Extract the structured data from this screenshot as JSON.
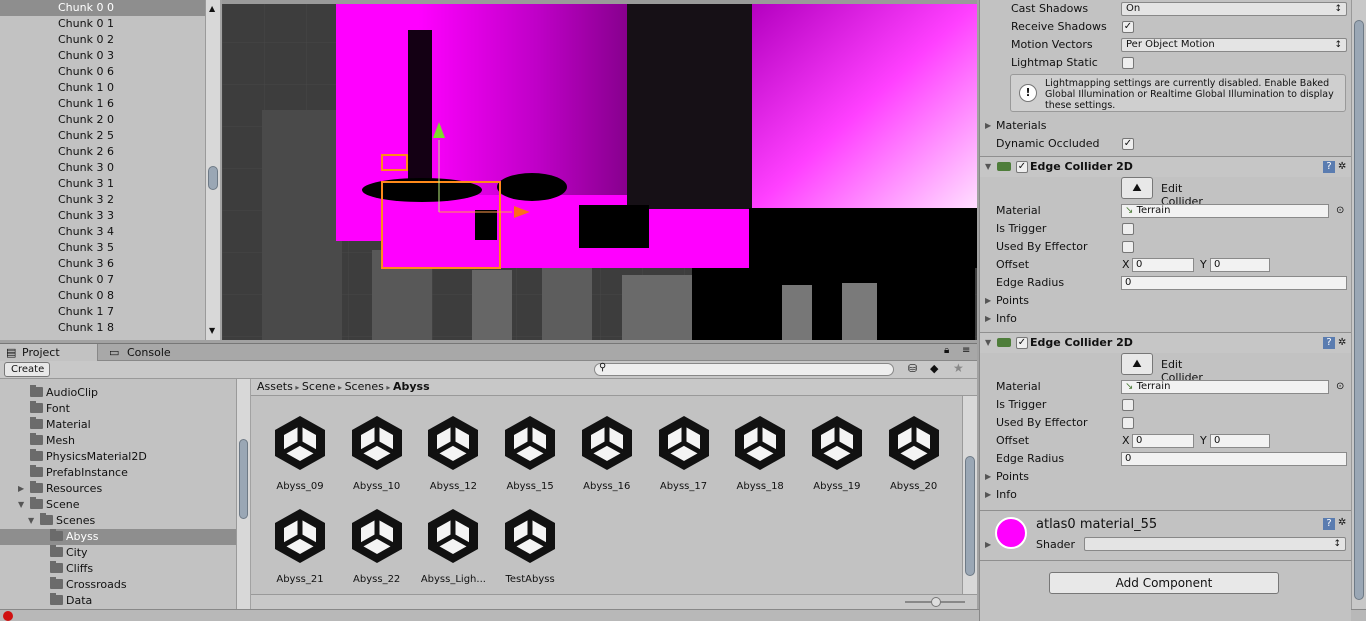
{
  "hierarchy": {
    "items": [
      "Chunk 0 0",
      "Chunk 0 1",
      "Chunk 0 2",
      "Chunk 0 3",
      "Chunk 0 6",
      "Chunk 1 0",
      "Chunk 1 6",
      "Chunk 2 0",
      "Chunk 2 5",
      "Chunk 2 6",
      "Chunk 3 0",
      "Chunk 3 1",
      "Chunk 3 2",
      "Chunk 3 3",
      "Chunk 3 4",
      "Chunk 3 5",
      "Chunk 3 6",
      "Chunk 0 7",
      "Chunk 0 8",
      "Chunk 1 7",
      "Chunk 1 8"
    ],
    "selected_index": 0
  },
  "project": {
    "tabs": [
      "Project",
      "Console"
    ],
    "create_label": "Create",
    "tree": [
      {
        "label": "AudioClip",
        "indent": 1
      },
      {
        "label": "Font",
        "indent": 1
      },
      {
        "label": "Material",
        "indent": 1
      },
      {
        "label": "Mesh",
        "indent": 1
      },
      {
        "label": "PhysicsMaterial2D",
        "indent": 1
      },
      {
        "label": "PrefabInstance",
        "indent": 1
      },
      {
        "label": "Resources",
        "indent": 1,
        "arrow": "right"
      },
      {
        "label": "Scene",
        "indent": 1,
        "arrow": "down"
      },
      {
        "label": "Scenes",
        "indent": 2,
        "arrow": "down"
      },
      {
        "label": "Abyss",
        "indent": 3,
        "selected": true
      },
      {
        "label": "City",
        "indent": 3
      },
      {
        "label": "Cliffs",
        "indent": 3
      },
      {
        "label": "Crossroads",
        "indent": 3
      },
      {
        "label": "Data",
        "indent": 3
      }
    ],
    "breadcrumb": [
      "Assets",
      "Scene",
      "Scenes",
      "Abyss"
    ],
    "assets_row1": [
      "Abyss_09",
      "Abyss_10",
      "Abyss_12",
      "Abyss_15",
      "Abyss_16",
      "Abyss_17",
      "Abyss_18",
      "Abyss_19",
      "Abyss_20"
    ],
    "assets_row2": [
      "Abyss_21",
      "Abyss_22",
      "Abyss_Ligh...",
      "TestAbyss"
    ]
  },
  "inspector": {
    "cast_shadows": {
      "label": "Cast Shadows",
      "value": "On"
    },
    "receive_shadows": {
      "label": "Receive Shadows",
      "checked": true
    },
    "motion_vectors": {
      "label": "Motion Vectors",
      "value": "Per Object Motion"
    },
    "lightmap_static": {
      "label": "Lightmap Static",
      "checked": false
    },
    "info_box": "Lightmapping settings are currently disabled. Enable Baked Global Illumination or Realtime Global Illumination to display these settings.",
    "materials_label": "Materials",
    "dynamic_occluded": {
      "label": "Dynamic Occluded",
      "checked": true
    },
    "colliders": [
      {
        "title": "Edge Collider 2D",
        "edit_label": "Edit Collider",
        "material_label": "Material",
        "material_value": "Terrain",
        "is_trigger": "Is Trigger",
        "used_by_effector": "Used By Effector",
        "offset_label": "Offset",
        "x_label": "X",
        "x": "0",
        "y_label": "Y",
        "y": "0",
        "edge_radius_label": "Edge Radius",
        "edge_radius": "0",
        "points": "Points",
        "info": "Info"
      },
      {
        "title": "Edge Collider 2D",
        "edit_label": "Edit Collider",
        "material_label": "Material",
        "material_value": "Terrain",
        "is_trigger": "Is Trigger",
        "used_by_effector": "Used By Effector",
        "offset_label": "Offset",
        "x_label": "X",
        "x": "0",
        "y_label": "Y",
        "y": "0",
        "edge_radius_label": "Edge Radius",
        "edge_radius": "0",
        "points": "Points",
        "info": "Info"
      }
    ],
    "material_name": "atlas0 material_55",
    "shader_label": "Shader",
    "add_component": "Add Component"
  },
  "colors": {
    "magenta": "#ff00ff",
    "selection": "#8e8e8e",
    "gizmo_orange": "#ff7a1a",
    "gizmo_green": "#7ddc2a"
  }
}
